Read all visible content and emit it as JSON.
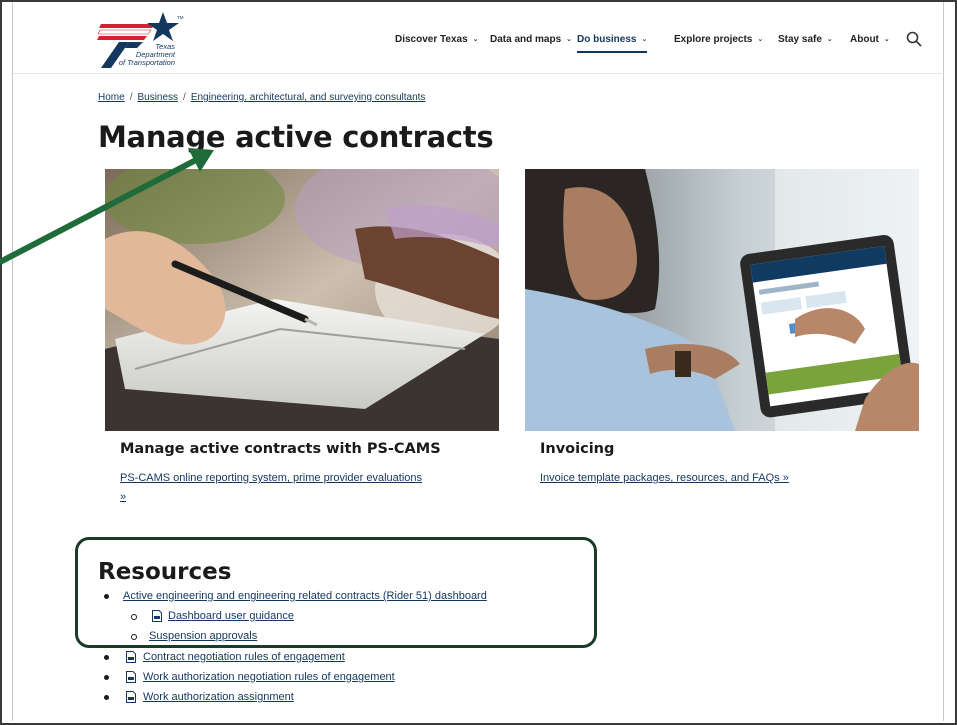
{
  "header": {
    "logo": {
      "line1": "Texas",
      "line2": "Department",
      "line3": "of Transportation",
      "tm": "TM"
    },
    "nav": [
      {
        "label": "Discover Texas",
        "active": false
      },
      {
        "label": "Data and maps",
        "active": false
      },
      {
        "label": "Do business",
        "active": true
      },
      {
        "label": "Explore projects",
        "active": false
      },
      {
        "label": "Stay safe",
        "active": false
      },
      {
        "label": "About",
        "active": false
      }
    ]
  },
  "breadcrumb": {
    "items": [
      "Home",
      "Business",
      "Engineering, architectural, and surveying consultants"
    ],
    "separator": "/"
  },
  "page": {
    "title": "Manage active contracts"
  },
  "cards": [
    {
      "title": "Manage active contracts with PS-CAMS",
      "link_line1": "PS-CAMS online reporting system, prime provider evaluations",
      "link_line2": "»"
    },
    {
      "title": "Invoicing",
      "link_line1": "Invoice template packages, resources, and FAQs  »"
    }
  ],
  "resources": {
    "title": "Resources",
    "items": [
      {
        "label": "Active engineering and engineering related contracts (Rider 51) dashboard",
        "pdf": false,
        "level": 1
      },
      {
        "label": "Dashboard user guidance",
        "pdf": true,
        "level": 2
      },
      {
        "label": "Suspension approvals",
        "pdf": false,
        "level": 2
      },
      {
        "label": "Contract negotiation rules of engagement",
        "pdf": true,
        "level": 1
      },
      {
        "label": "Work authorization negotiation rules of engagement",
        "pdf": true,
        "level": 1
      },
      {
        "label": "Work authorization assignment",
        "pdf": true,
        "level": 1
      }
    ]
  },
  "colors": {
    "brand_navy": "#14375e",
    "brand_red": "#d62030",
    "annotation_arrow": "#1f6b3a",
    "annotation_box": "#1a3b2a"
  },
  "icons": [
    "search-icon",
    "chevron-down-icon",
    "pdf-icon"
  ]
}
